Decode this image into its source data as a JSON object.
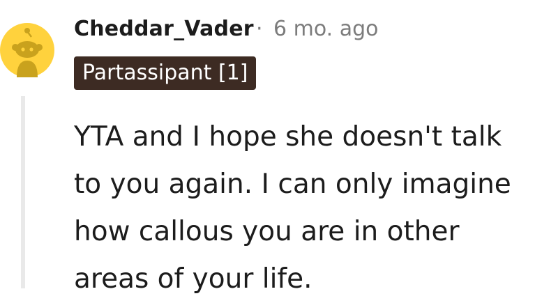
{
  "comment": {
    "author": "Cheddar_Vader",
    "separator": "·",
    "timestamp": "6 mo. ago",
    "flair": "Partassipant [1]",
    "body": "YTA and I hope she doesn't talk to you again. I can only imagine how callous you are in other areas of your life."
  },
  "colors": {
    "avatar_background": "#ffd23d",
    "flair_background": "#3d2b23",
    "thread_line": "#e9e9e9",
    "text": "#1c1c1c",
    "meta_text": "#7c7c7c"
  },
  "icons": {
    "avatar": "snoo-avatar-icon"
  }
}
